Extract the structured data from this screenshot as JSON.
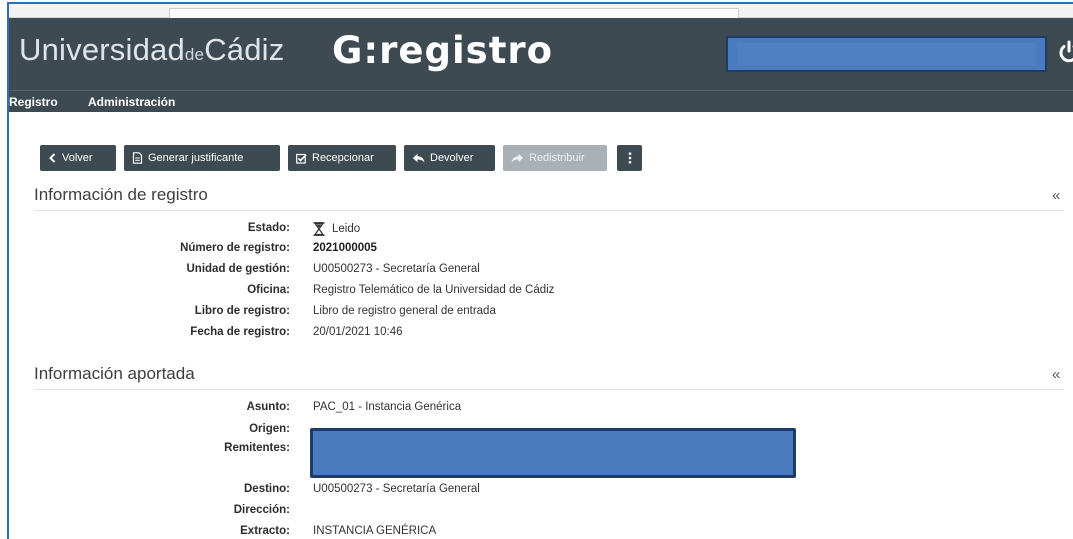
{
  "header": {
    "university_prefix": "Universidad",
    "university_de": "de",
    "university_suffix": "Cádiz",
    "app_logo": "G:registro",
    "power_icon": "power-icon"
  },
  "menu": {
    "items": [
      {
        "label": "Registro"
      },
      {
        "label": "Administración"
      }
    ]
  },
  "toolbar": {
    "buttons": [
      {
        "label": "Volver",
        "icon": "chevron-left-icon",
        "enabled": true
      },
      {
        "label": "Generar justificante",
        "icon": "document-icon",
        "enabled": true
      },
      {
        "label": "Recepcionar",
        "icon": "checkbox-icon",
        "enabled": true
      },
      {
        "label": "Devolver",
        "icon": "share-back-icon",
        "enabled": true
      },
      {
        "label": "Redistribuir",
        "icon": "share-forward-icon",
        "enabled": false
      },
      {
        "label": "",
        "icon": "more-vertical-icon",
        "enabled": true
      }
    ]
  },
  "registro": {
    "title": "Información de registro",
    "collapse": "«",
    "fields": [
      {
        "label": "Estado:",
        "value": "Leido",
        "icon": "hourglass-icon"
      },
      {
        "label": "Número de registro:",
        "value": "2021000005"
      },
      {
        "label": "Unidad de gestión:",
        "value": "U00500273 - Secretaría General"
      },
      {
        "label": "Oficina:",
        "value": "Registro Telemático de la Universidad de Cádiz"
      },
      {
        "label": "Libro de registro:",
        "value": "Libro de registro general de entrada"
      },
      {
        "label": "Fecha de registro:",
        "value": "20/01/2021 10:46"
      }
    ]
  },
  "aportada": {
    "title": "Información aportada",
    "collapse": "«",
    "fields": [
      {
        "label": "Asunto:",
        "value": "PAC_01 - Instancia Genérica"
      },
      {
        "label": "Origen:",
        "value": ""
      },
      {
        "label": "Remitentes:",
        "value": ""
      },
      {
        "label": "Destino:",
        "value": "U00500273 - Secretaría General"
      },
      {
        "label": "Dirección:",
        "value": ""
      },
      {
        "label": "Extracto:",
        "value": "INSTANCIA GENÉRICA"
      }
    ]
  },
  "colors": {
    "header_bg": "#3e4a52",
    "button_bg": "#3e4a52",
    "button_disabled_bg": "#a9b0b6",
    "redaction": "#4a7bbf"
  }
}
